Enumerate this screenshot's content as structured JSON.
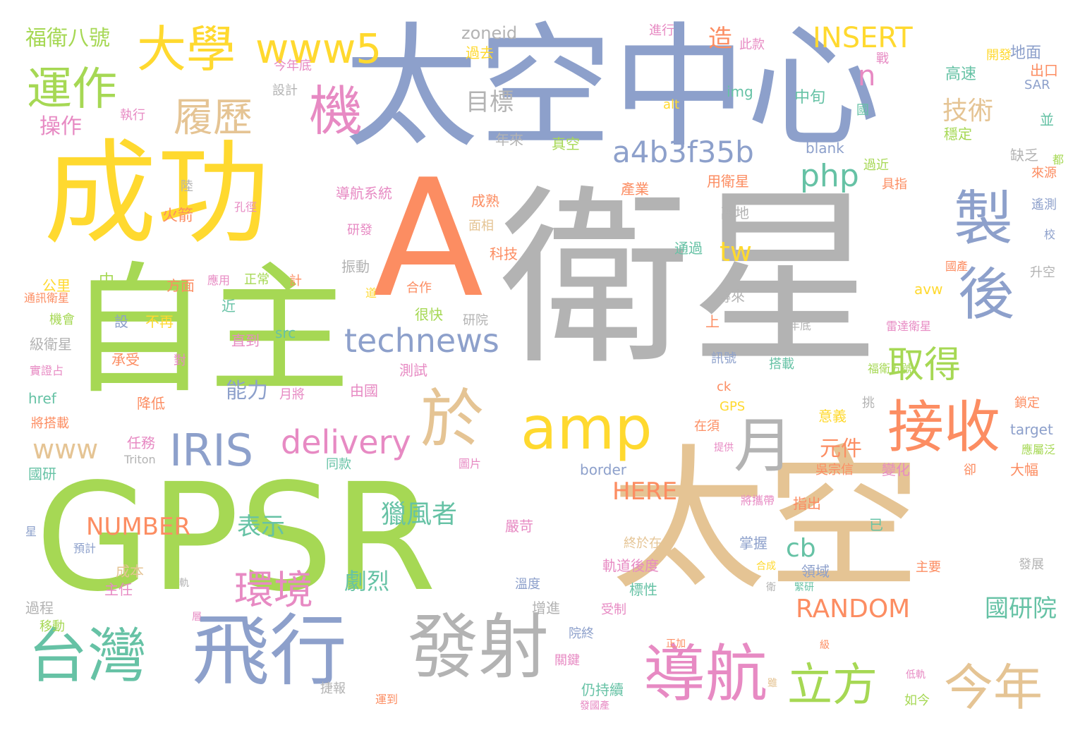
{
  "palette": {
    "yellow": "#FFD92F",
    "green": "#A6D854",
    "blue": "#8DA0CB",
    "gray": "#B3B3B3",
    "tan": "#E5C494",
    "orange": "#FC8D62",
    "pink": "#E78AC3",
    "teal": "#66C2A5"
  },
  "background_color": "#ffffff",
  "words": [
    "太空中心",
    "衛星",
    "GPSR",
    "太空",
    "成功",
    "自主",
    "A",
    "飛行",
    "發射",
    "台灣",
    "於",
    "amp",
    "導航",
    "接收",
    "製",
    "後",
    "大學",
    "運作",
    "機",
    "月",
    "今年",
    "立方",
    "IRIS",
    "technews",
    "delivery",
    "www5",
    "履歷",
    "取得",
    "環境",
    "a4b3f35b",
    "www",
    "php",
    "福衛八號",
    "INSERT",
    "技術",
    "目標",
    "操作",
    "tw",
    "表示",
    "NUMBER",
    "獵風者",
    "RANDOM",
    "國研院",
    "能力",
    "元件",
    "HERE",
    "劇烈",
    "cb",
    "n",
    "造",
    "zoneid",
    "進行",
    "此款",
    "地面",
    "今年底",
    "過去",
    "戰",
    "開發",
    "出口",
    "設計",
    "執行",
    "img",
    "中旬",
    "高速",
    "SAR",
    "alt",
    "國",
    "並",
    "年來",
    "真空",
    "blank",
    "穩定",
    "缺乏",
    "陸",
    "導航系統",
    "過近",
    "具指",
    "來源",
    "都",
    "火箭",
    "孔徑",
    "成熟",
    "產業",
    "用衛星",
    "遙測",
    "研發",
    "面相",
    "離地",
    "校",
    "科技",
    "通過",
    "振動",
    "國產",
    "公里",
    "中",
    "應用",
    "正常",
    "計",
    "升空",
    "方面",
    "通訊衛星",
    "近",
    "道",
    "合作",
    "上",
    "傳來",
    "avw",
    "機會",
    "設",
    "不再",
    "很快",
    "研院",
    "年底",
    "雷達衛星",
    "src",
    "級衛星",
    "直到",
    "承受",
    "對",
    "實證占",
    "測試",
    "訊號",
    "搭載",
    "福衛五號",
    "href",
    "月將",
    "由國",
    "ck",
    "降低",
    "挑",
    "鎖定",
    "GPS",
    "將搭載",
    "在須",
    "意義",
    "target",
    "任務",
    "提供",
    "Triton",
    "圖片",
    "同款",
    "border",
    "吳宗信",
    "變化",
    "卻",
    "大幅",
    "國研",
    "應屬泛",
    "將攜帶",
    "指出",
    "已",
    "星",
    "預計",
    "嚴苛",
    "終於在",
    "掌握",
    "領域",
    "成本",
    "軌道後度",
    "合成",
    "主要",
    "發展",
    "軌",
    "主任",
    "溫度",
    "標性",
    "緊研",
    "衛",
    "過程",
    "增進",
    "受制",
    "層",
    "移動",
    "院終",
    "級",
    "正加",
    "關鍵",
    "捷報",
    "仍持續",
    "雖",
    "低軌",
    "運到",
    "如今",
    "發國產"
  ]
}
